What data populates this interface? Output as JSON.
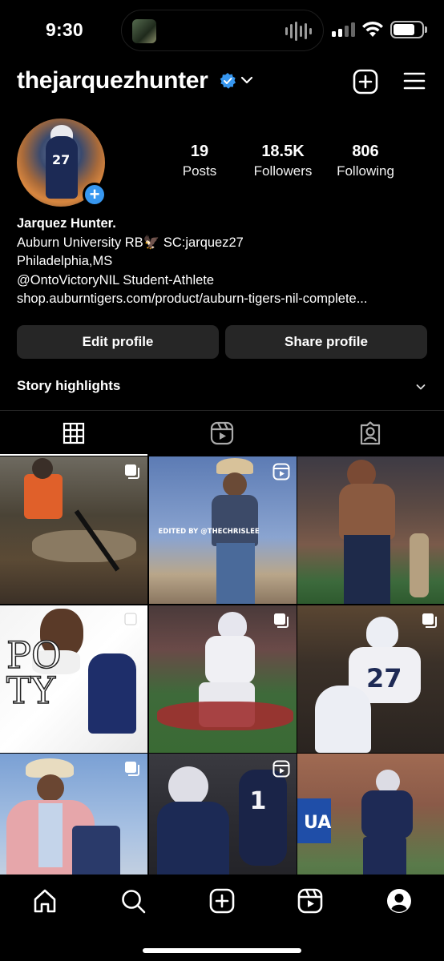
{
  "status_bar": {
    "time": "9:30",
    "battery_percent": 70
  },
  "header": {
    "username": "thejarquezhunter",
    "verified": true
  },
  "profile": {
    "stats": [
      {
        "value": "19",
        "label": "Posts"
      },
      {
        "value": "18.5K",
        "label": "Followers"
      },
      {
        "value": "806",
        "label": "Following"
      }
    ],
    "bio": {
      "name": "Jarquez Hunter.",
      "line1": "Auburn University RB🦅 SC:jarquez27",
      "line2": "Philadelphia,MS",
      "line3": "@OntoVictoryNIL Student-Athlete",
      "link": "shop.auburntigers.com/product/auburn-tigers-nil-complete..."
    }
  },
  "actions": {
    "edit_label": "Edit profile",
    "share_label": "Share profile"
  },
  "highlights": {
    "label": "Story highlights"
  },
  "tabs": [
    "grid-icon",
    "reels-icon",
    "tagged-icon"
  ],
  "grid": [
    {
      "kind": "carousel",
      "theme": "hunting"
    },
    {
      "kind": "reel",
      "theme": "cowboy",
      "caption": "EDITED BY @THECHRISLEE"
    },
    {
      "kind": "none",
      "theme": "stadium-shirtless"
    },
    {
      "kind": "carousel",
      "theme": "poty",
      "caption": "PO TY"
    },
    {
      "kind": "carousel",
      "theme": "game-run"
    },
    {
      "kind": "carousel",
      "theme": "jersey-27"
    },
    {
      "kind": "carousel",
      "theme": "pink-suit"
    },
    {
      "kind": "reel",
      "theme": "team-sideline"
    },
    {
      "kind": "none",
      "theme": "practice-catch"
    }
  ],
  "colors": {
    "accent": "#3797f0",
    "button_bg": "#262626",
    "background": "#000000"
  }
}
